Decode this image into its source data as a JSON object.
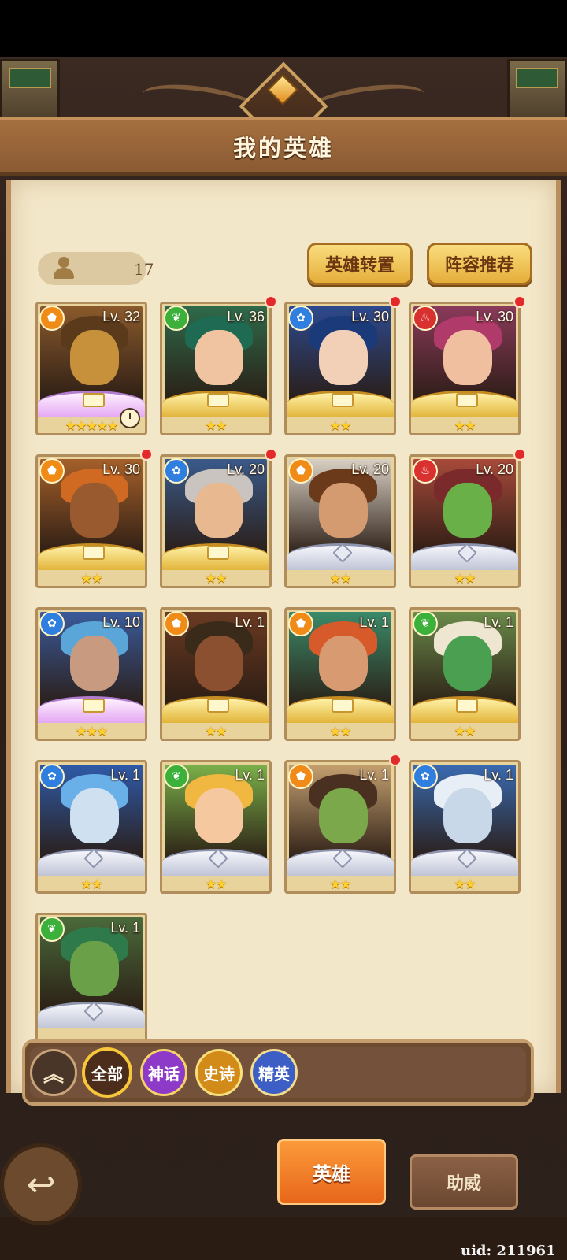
{
  "header": {
    "title": "我的英雄"
  },
  "toolbar": {
    "hero_count": "17",
    "convert_label": "英雄转置",
    "lineup_label": "阵容推荐"
  },
  "colors": {
    "orange": "#f08b18",
    "green": "#3bb03a",
    "blue": "#2f7fe0",
    "red": "#d93030"
  },
  "heroes": [
    {
      "level": "Lv. 32",
      "element": "orange",
      "stars": 5,
      "frame": "purple",
      "notification": false,
      "timer": true,
      "bg": "#8a5a2c",
      "face": "#c7913c",
      "hair": "#5a3a1a"
    },
    {
      "level": "Lv. 36",
      "element": "green",
      "stars": 2,
      "frame": "gold",
      "notification": true,
      "bg": "#2f6a4a",
      "face": "#f0c4a0",
      "hair": "#1e6a52"
    },
    {
      "level": "Lv. 30",
      "element": "blue",
      "stars": 2,
      "frame": "gold",
      "notification": true,
      "bg": "#2d4a8e",
      "face": "#f2d0b8",
      "hair": "#1b3a7a"
    },
    {
      "level": "Lv. 30",
      "element": "red",
      "stars": 2,
      "frame": "gold",
      "notification": true,
      "bg": "#8a3a5a",
      "face": "#f0bfa0",
      "hair": "#b03a6a"
    },
    {
      "level": "Lv. 30",
      "element": "orange",
      "stars": 2,
      "frame": "gold",
      "notification": true,
      "bg": "#a5602a",
      "face": "#9a5a30",
      "hair": "#d06a22"
    },
    {
      "level": "Lv. 20",
      "element": "blue",
      "stars": 2,
      "frame": "gold",
      "notification": true,
      "bg": "#3a5a8a",
      "face": "#e8b890",
      "hair": "#c9c4c0"
    },
    {
      "level": "Lv. 20",
      "element": "orange",
      "stars": 2,
      "frame": "silver",
      "notification": false,
      "bg": "#d9d0c4",
      "face": "#d49a70",
      "hair": "#6a3a1a"
    },
    {
      "level": "Lv. 20",
      "element": "red",
      "stars": 2,
      "frame": "silver",
      "notification": true,
      "bg": "#a84a3a",
      "face": "#6ab048",
      "hair": "#7a2a2a"
    },
    {
      "level": "Lv. 10",
      "element": "blue",
      "stars": 3,
      "frame": "purple",
      "notification": false,
      "bg": "#3a5a9a",
      "face": "#c89a80",
      "hair": "#5aa6d8"
    },
    {
      "level": "Lv. 1",
      "element": "orange",
      "stars": 2,
      "frame": "gold",
      "notification": false,
      "bg": "#6a3a22",
      "face": "#8a5030",
      "hair": "#3a2a1a"
    },
    {
      "level": "Lv. 1",
      "element": "orange",
      "stars": 2,
      "frame": "gold",
      "notification": false,
      "bg": "#3a8a6a",
      "face": "#d89a70",
      "hair": "#d65a2a"
    },
    {
      "level": "Lv. 1",
      "element": "green",
      "stars": 2,
      "frame": "gold",
      "notification": false,
      "bg": "#6a8a4a",
      "face": "#4aa050",
      "hair": "#efe6d2"
    },
    {
      "level": "Lv. 1",
      "element": "blue",
      "stars": 2,
      "frame": "silver",
      "notification": false,
      "bg": "#2f5aa8",
      "face": "#cfe0f0",
      "hair": "#6ab0e8"
    },
    {
      "level": "Lv. 1",
      "element": "green",
      "stars": 2,
      "frame": "silver",
      "notification": false,
      "bg": "#7ab04a",
      "face": "#f5c8a0",
      "hair": "#f0b840"
    },
    {
      "level": "Lv. 1",
      "element": "orange",
      "stars": 2,
      "frame": "silver",
      "notification": true,
      "bg": "#c4a070",
      "face": "#7aa84a",
      "hair": "#4a3020"
    },
    {
      "level": "Lv. 1",
      "element": "blue",
      "stars": 2,
      "frame": "silver",
      "notification": false,
      "bg": "#3a6ab0",
      "face": "#c8d8e8",
      "hair": "#e8eef6"
    },
    {
      "level": "Lv. 1",
      "element": "green",
      "stars": 0,
      "frame": "silver",
      "notification": false,
      "bg": "#4a6a3a",
      "face": "#6aa048",
      "hair": "#2f7a4a"
    }
  ],
  "filters": {
    "all": "全部",
    "myth": "神话",
    "epic": "史诗",
    "elite": "精英"
  },
  "nav": {
    "heroes_tab": "英雄",
    "aid_tab": "助威"
  },
  "footer": {
    "uid": "uid: 211961"
  }
}
